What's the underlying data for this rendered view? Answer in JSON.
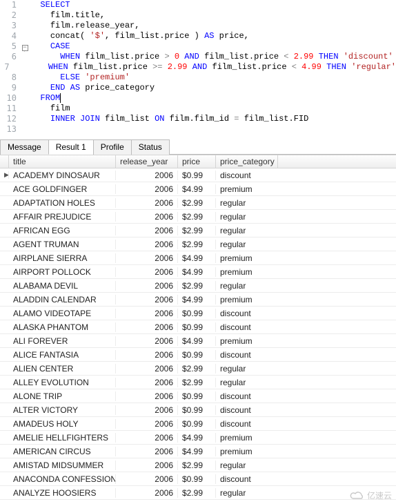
{
  "code": {
    "lines": [
      {
        "n": 1,
        "indent": "  ",
        "tokens": [
          {
            "t": "SELECT",
            "c": "kw"
          }
        ]
      },
      {
        "n": 2,
        "indent": "    ",
        "tokens": [
          {
            "t": "film.title,",
            "c": ""
          }
        ]
      },
      {
        "n": 3,
        "indent": "    ",
        "tokens": [
          {
            "t": "film.release_year,",
            "c": ""
          }
        ]
      },
      {
        "n": 4,
        "indent": "    ",
        "tokens": [
          {
            "t": "concat( ",
            "c": ""
          },
          {
            "t": "'$'",
            "c": "str"
          },
          {
            "t": ", film_list.price ) ",
            "c": ""
          },
          {
            "t": "AS",
            "c": "kw"
          },
          {
            "t": " price,",
            "c": ""
          }
        ]
      },
      {
        "n": 5,
        "indent": "    ",
        "fold": "start",
        "tokens": [
          {
            "t": "CASE",
            "c": "kw"
          }
        ]
      },
      {
        "n": 6,
        "indent": "      ",
        "fold": "mid",
        "tokens": [
          {
            "t": "WHEN",
            "c": "kw"
          },
          {
            "t": " film_list.price ",
            "c": ""
          },
          {
            "t": ">",
            "c": "op"
          },
          {
            "t": " ",
            "c": ""
          },
          {
            "t": "0",
            "c": "num"
          },
          {
            "t": " ",
            "c": ""
          },
          {
            "t": "AND",
            "c": "kw"
          },
          {
            "t": " film_list.price ",
            "c": ""
          },
          {
            "t": "<",
            "c": "op"
          },
          {
            "t": " ",
            "c": ""
          },
          {
            "t": "2.99",
            "c": "num"
          },
          {
            "t": " ",
            "c": ""
          },
          {
            "t": "THEN",
            "c": "kw"
          },
          {
            "t": " ",
            "c": ""
          },
          {
            "t": "'discount'",
            "c": "str"
          }
        ]
      },
      {
        "n": 7,
        "indent": "      ",
        "fold": "mid",
        "tokens": [
          {
            "t": "WHEN",
            "c": "kw"
          },
          {
            "t": " film_list.price ",
            "c": ""
          },
          {
            "t": ">=",
            "c": "op"
          },
          {
            "t": " ",
            "c": ""
          },
          {
            "t": "2.99",
            "c": "num"
          },
          {
            "t": " ",
            "c": ""
          },
          {
            "t": "AND",
            "c": "kw"
          },
          {
            "t": " film_list.price ",
            "c": ""
          },
          {
            "t": "<",
            "c": "op"
          },
          {
            "t": " ",
            "c": ""
          },
          {
            "t": "4.99",
            "c": "num"
          },
          {
            "t": " ",
            "c": ""
          },
          {
            "t": "THEN",
            "c": "kw"
          },
          {
            "t": " ",
            "c": ""
          },
          {
            "t": "'regular'",
            "c": "str"
          }
        ]
      },
      {
        "n": 8,
        "indent": "      ",
        "fold": "mid",
        "tokens": [
          {
            "t": "ELSE",
            "c": "kw"
          },
          {
            "t": " ",
            "c": ""
          },
          {
            "t": "'premium'",
            "c": "str"
          }
        ]
      },
      {
        "n": 9,
        "indent": "    ",
        "fold": "end",
        "tokens": [
          {
            "t": "END",
            "c": "kw"
          },
          {
            "t": " ",
            "c": ""
          },
          {
            "t": "AS",
            "c": "kw"
          },
          {
            "t": " price_category",
            "c": ""
          }
        ]
      },
      {
        "n": 10,
        "indent": "  ",
        "cursor": true,
        "tokens": [
          {
            "t": "FROM",
            "c": "kw"
          }
        ]
      },
      {
        "n": 11,
        "indent": "    ",
        "tokens": [
          {
            "t": "film",
            "c": ""
          }
        ]
      },
      {
        "n": 12,
        "indent": "    ",
        "tokens": [
          {
            "t": "INNER",
            "c": "kw"
          },
          {
            "t": " ",
            "c": ""
          },
          {
            "t": "JOIN",
            "c": "kw"
          },
          {
            "t": " film_list ",
            "c": ""
          },
          {
            "t": "ON",
            "c": "kw"
          },
          {
            "t": " film.film_id ",
            "c": ""
          },
          {
            "t": "=",
            "c": "op"
          },
          {
            "t": " film_list.FID",
            "c": ""
          }
        ]
      },
      {
        "n": 13,
        "indent": "",
        "tokens": []
      }
    ]
  },
  "tabs": {
    "items": [
      "Message",
      "Result 1",
      "Profile",
      "Status"
    ],
    "active": 1
  },
  "grid": {
    "columns": [
      "title",
      "release_year",
      "price",
      "price_category"
    ],
    "rows": [
      {
        "sel": true,
        "title": "ACADEMY DINOSAUR",
        "year": "2006",
        "price": "$0.99",
        "cat": "discount"
      },
      {
        "title": "ACE GOLDFINGER",
        "year": "2006",
        "price": "$4.99",
        "cat": "premium"
      },
      {
        "title": "ADAPTATION HOLES",
        "year": "2006",
        "price": "$2.99",
        "cat": "regular"
      },
      {
        "title": "AFFAIR PREJUDICE",
        "year": "2006",
        "price": "$2.99",
        "cat": "regular"
      },
      {
        "title": "AFRICAN EGG",
        "year": "2006",
        "price": "$2.99",
        "cat": "regular"
      },
      {
        "title": "AGENT TRUMAN",
        "year": "2006",
        "price": "$2.99",
        "cat": "regular"
      },
      {
        "title": "AIRPLANE SIERRA",
        "year": "2006",
        "price": "$4.99",
        "cat": "premium"
      },
      {
        "title": "AIRPORT POLLOCK",
        "year": "2006",
        "price": "$4.99",
        "cat": "premium"
      },
      {
        "title": "ALABAMA DEVIL",
        "year": "2006",
        "price": "$2.99",
        "cat": "regular"
      },
      {
        "title": "ALADDIN CALENDAR",
        "year": "2006",
        "price": "$4.99",
        "cat": "premium"
      },
      {
        "title": "ALAMO VIDEOTAPE",
        "year": "2006",
        "price": "$0.99",
        "cat": "discount"
      },
      {
        "title": "ALASKA PHANTOM",
        "year": "2006",
        "price": "$0.99",
        "cat": "discount"
      },
      {
        "title": "ALI FOREVER",
        "year": "2006",
        "price": "$4.99",
        "cat": "premium"
      },
      {
        "title": "ALICE FANTASIA",
        "year": "2006",
        "price": "$0.99",
        "cat": "discount"
      },
      {
        "title": "ALIEN CENTER",
        "year": "2006",
        "price": "$2.99",
        "cat": "regular"
      },
      {
        "title": "ALLEY EVOLUTION",
        "year": "2006",
        "price": "$2.99",
        "cat": "regular"
      },
      {
        "title": "ALONE TRIP",
        "year": "2006",
        "price": "$0.99",
        "cat": "discount"
      },
      {
        "title": "ALTER VICTORY",
        "year": "2006",
        "price": "$0.99",
        "cat": "discount"
      },
      {
        "title": "AMADEUS HOLY",
        "year": "2006",
        "price": "$0.99",
        "cat": "discount"
      },
      {
        "title": "AMELIE HELLFIGHTERS",
        "year": "2006",
        "price": "$4.99",
        "cat": "premium"
      },
      {
        "title": "AMERICAN CIRCUS",
        "year": "2006",
        "price": "$4.99",
        "cat": "premium"
      },
      {
        "title": "AMISTAD MIDSUMMER",
        "year": "2006",
        "price": "$2.99",
        "cat": "regular"
      },
      {
        "title": "ANACONDA CONFESSIONS",
        "year": "2006",
        "price": "$0.99",
        "cat": "discount"
      },
      {
        "title": "ANALYZE HOOSIERS",
        "year": "2006",
        "price": "$2.99",
        "cat": "regular"
      }
    ]
  },
  "watermark": {
    "text": "亿速云"
  }
}
